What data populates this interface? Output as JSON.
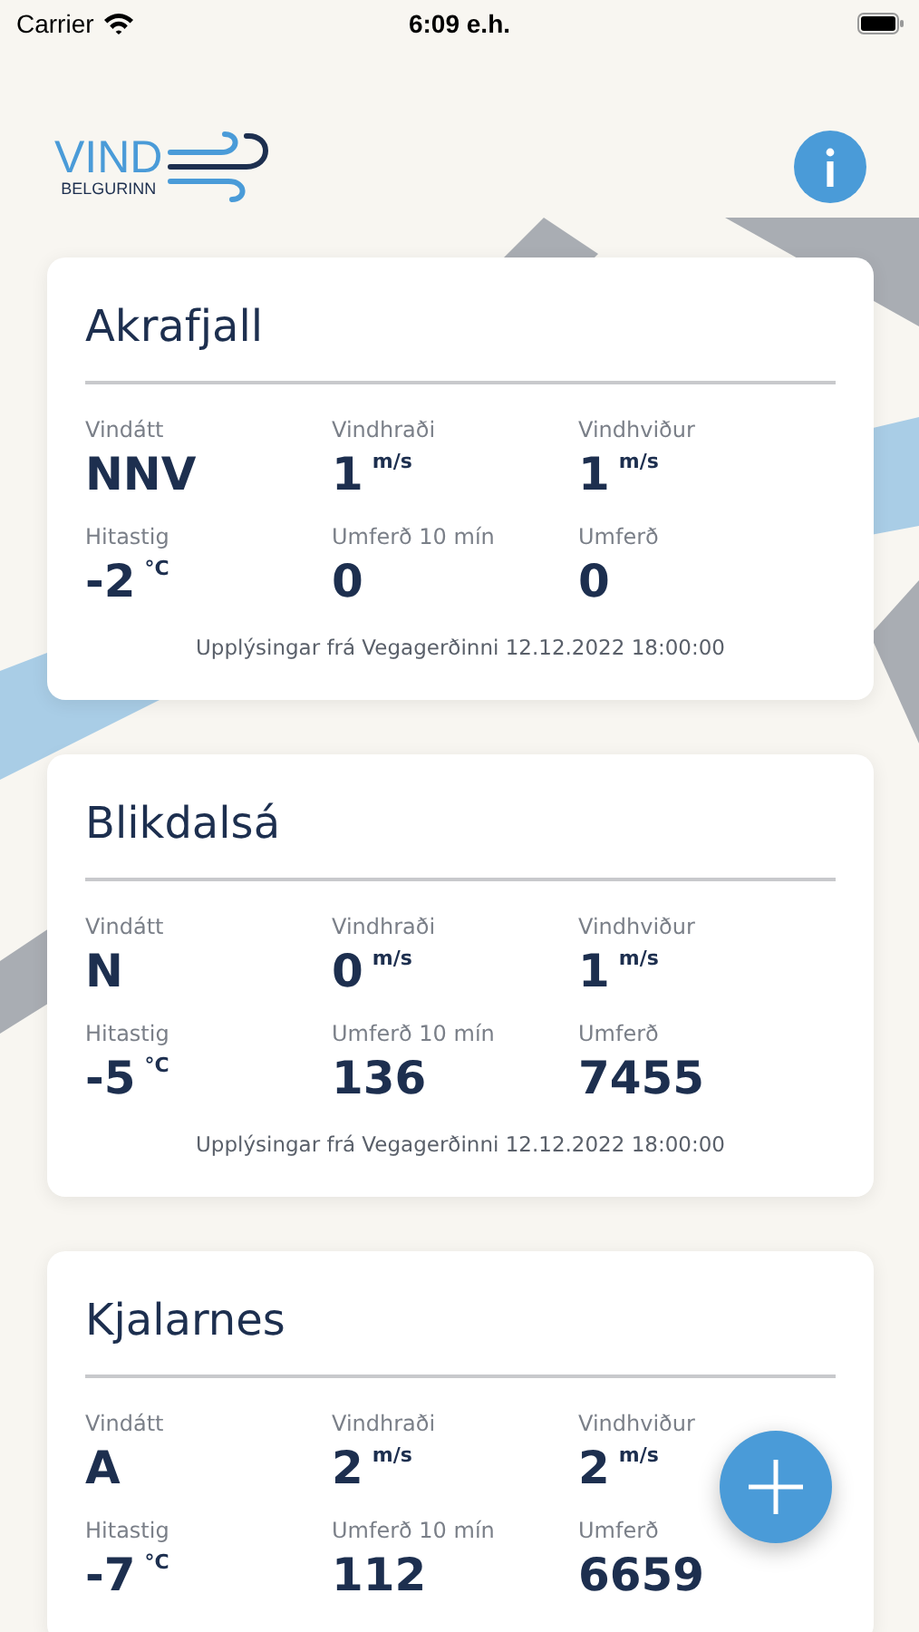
{
  "status_bar": {
    "carrier": "Carrier",
    "time": "6:09 e.h."
  },
  "header": {
    "logo_title": "VIND",
    "logo_subtitle": "BELGURINN"
  },
  "stations": [
    {
      "name": "Akrafjall",
      "metrics": [
        {
          "label": "Vindátt",
          "value": "NNV"
        },
        {
          "label": "Vindhraði",
          "value": "1",
          "unit": "m/s"
        },
        {
          "label": "Vindhviður",
          "value": "1",
          "unit": "m/s"
        },
        {
          "label": "Hitastig",
          "value": "-2",
          "unit": "°C"
        },
        {
          "label": "Umferð 10 mín",
          "value": "0"
        },
        {
          "label": "Umferð",
          "value": "0"
        }
      ],
      "source": "Upplýsingar frá Vegagerðinni 12.12.2022 18:00:00"
    },
    {
      "name": "Blikdalsá",
      "metrics": [
        {
          "label": "Vindátt",
          "value": "N"
        },
        {
          "label": "Vindhraði",
          "value": "0",
          "unit": "m/s"
        },
        {
          "label": "Vindhviður",
          "value": "1",
          "unit": "m/s"
        },
        {
          "label": "Hitastig",
          "value": "-5",
          "unit": "°C"
        },
        {
          "label": "Umferð 10 mín",
          "value": "136"
        },
        {
          "label": "Umferð",
          "value": "7455"
        }
      ],
      "source": "Upplýsingar frá Vegagerðinni 12.12.2022 18:00:00"
    },
    {
      "name": "Kjalarnes",
      "metrics": [
        {
          "label": "Vindátt",
          "value": "A"
        },
        {
          "label": "Vindhraði",
          "value": "2",
          "unit": "m/s"
        },
        {
          "label": "Vindhviður",
          "value": "2",
          "unit": "m/s"
        },
        {
          "label": "Hitastig",
          "value": "-7",
          "unit": "°C"
        },
        {
          "label": "Umferð 10 mín",
          "value": "112"
        },
        {
          "label": "Umferð",
          "value": "6659"
        }
      ]
    }
  ]
}
